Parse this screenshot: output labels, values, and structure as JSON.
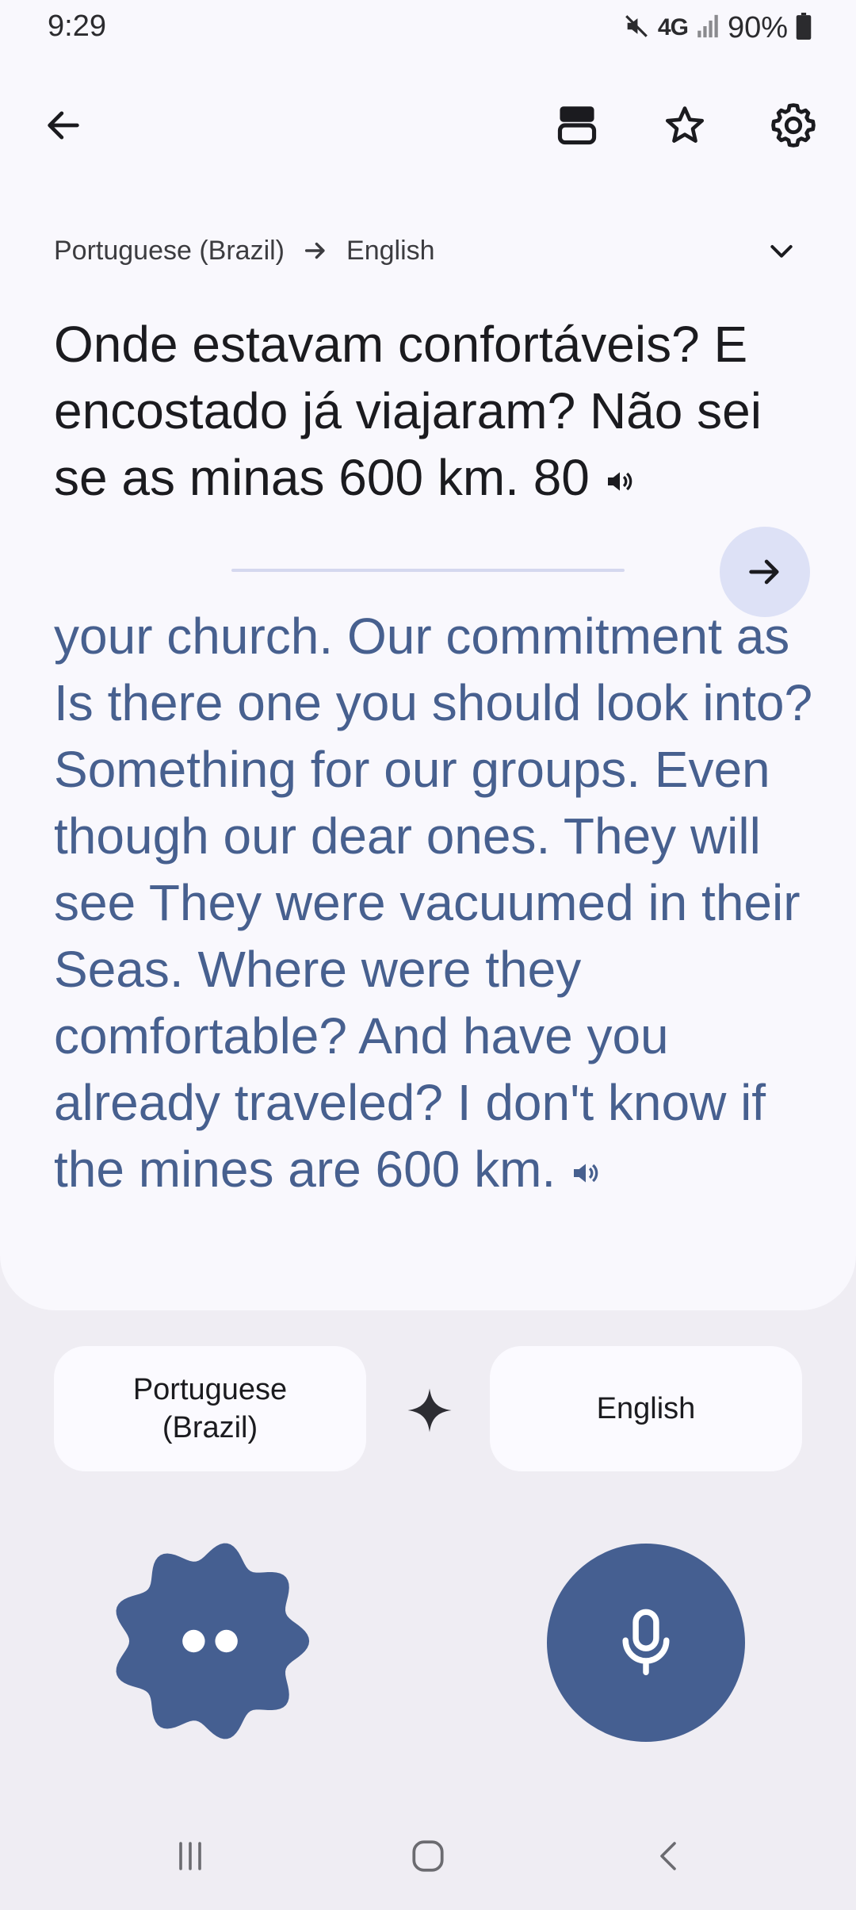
{
  "status_bar": {
    "time": "9:29",
    "network": "4G",
    "battery": "90%"
  },
  "app_bar": {
    "back_icon": "arrow-left-icon",
    "saved_icon": "saved-stack-icon",
    "star_icon": "star-outline-icon",
    "settings_icon": "gear-icon"
  },
  "language_row": {
    "source": "Portuguese (Brazil)",
    "target": "English"
  },
  "source_text": "Onde estavam confortáveis? E encostado já viajaram? Não sei se as minas 600 km. 80",
  "translation_text": "your church. Our commitment as Is there one you should look into? Something for our groups. Even though our dear ones. They will see They were vacuumed in their Seas. Where were they comfortable? And have you already traveled? I don't know if the mines are 600 km.",
  "language_pickers": {
    "source_line1": "Portuguese",
    "source_line2": "(Brazil)",
    "target": "English"
  },
  "colors": {
    "accent": "#455f91",
    "translation": "#47608f",
    "card": "#f9f8fd",
    "background": "#efedf3"
  }
}
